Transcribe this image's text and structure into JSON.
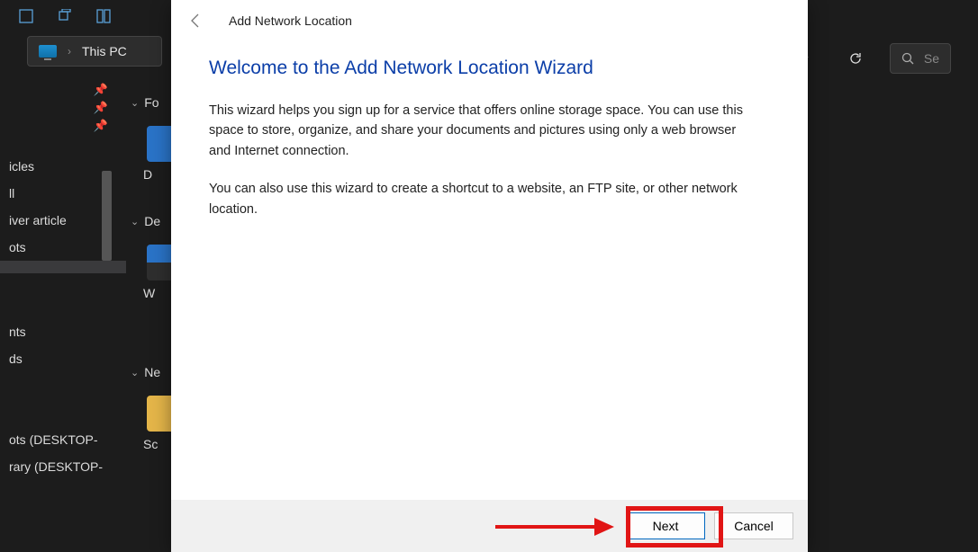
{
  "explorer": {
    "breadcrumb": "This PC",
    "search_placeholder": "Se",
    "sidebar_items": [
      "icles",
      "ll",
      "iver article",
      "ots",
      "",
      "",
      "nts",
      "ds",
      "",
      "ots (DESKTOP-",
      "rary (DESKTOP-"
    ],
    "sections": {
      "folders": {
        "head": "Fo",
        "item": "D"
      },
      "devices": {
        "head": "De",
        "item": "W"
      },
      "network": {
        "head": "Ne",
        "item": "Sc"
      }
    }
  },
  "wizard": {
    "title_small": "Add Network Location",
    "heading": "Welcome to the Add Network Location Wizard",
    "para1": "This wizard helps you sign up for a service that offers online storage space.  You can use this space to store, organize, and share your documents and pictures using only a web browser and Internet connection.",
    "para2": "You can also use this wizard to create a shortcut to a website, an FTP site, or other network location.",
    "next_label": "Next",
    "cancel_label": "Cancel"
  }
}
